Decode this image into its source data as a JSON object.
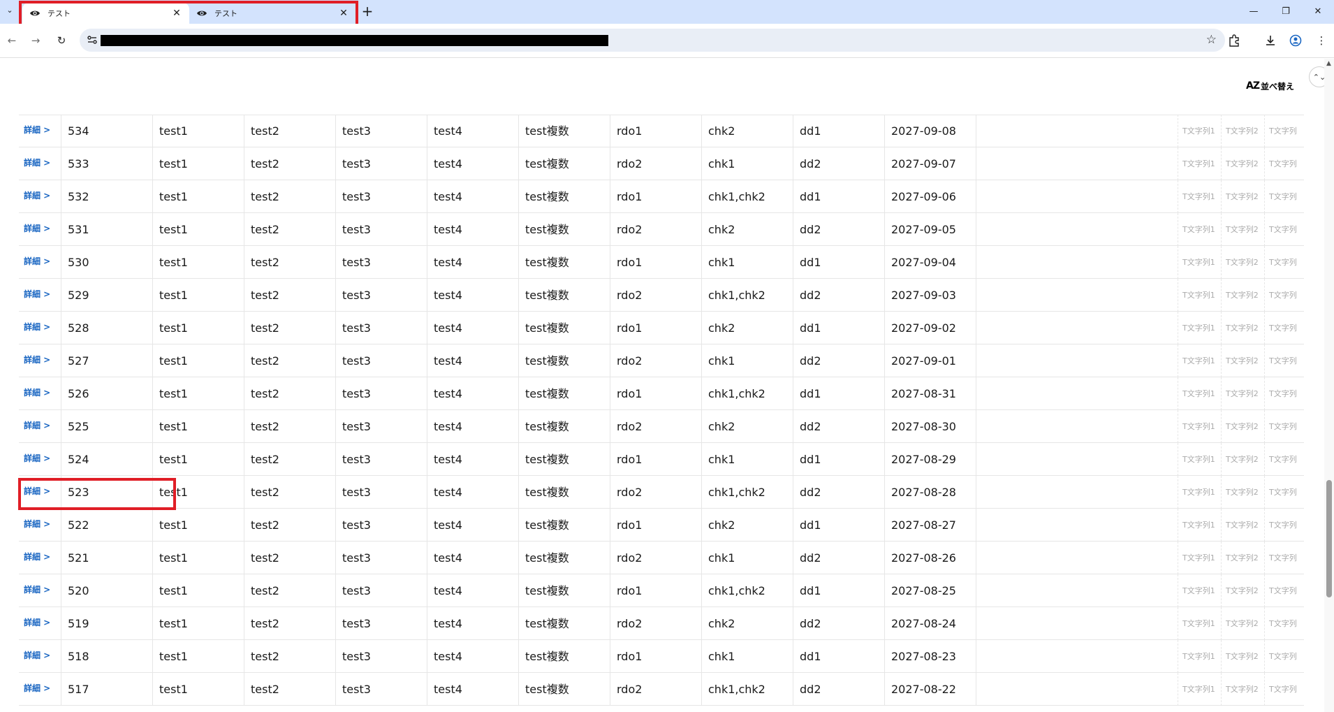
{
  "browser": {
    "tabs": [
      {
        "title": "テスト",
        "active": true
      },
      {
        "title": "テスト",
        "active": false
      }
    ],
    "tab_close": "✕",
    "new_tab": "+"
  },
  "page": {
    "sort_button": {
      "az": "AZ",
      "label": "並べ替え"
    },
    "detail_label": "詳細 >",
    "rows": [
      {
        "id": "534",
        "c1": "test1",
        "c2": "test2",
        "c3": "test3",
        "c4": "test4",
        "c5": "test複数",
        "rdo": "rdo1",
        "chk": "chk2",
        "dd": "dd1",
        "date": "2027-09-08"
      },
      {
        "id": "533",
        "c1": "test1",
        "c2": "test2",
        "c3": "test3",
        "c4": "test4",
        "c5": "test複数",
        "rdo": "rdo2",
        "chk": "chk1",
        "dd": "dd2",
        "date": "2027-09-07"
      },
      {
        "id": "532",
        "c1": "test1",
        "c2": "test2",
        "c3": "test3",
        "c4": "test4",
        "c5": "test複数",
        "rdo": "rdo1",
        "chk": "chk1,chk2",
        "dd": "dd1",
        "date": "2027-09-06"
      },
      {
        "id": "531",
        "c1": "test1",
        "c2": "test2",
        "c3": "test3",
        "c4": "test4",
        "c5": "test複数",
        "rdo": "rdo2",
        "chk": "chk2",
        "dd": "dd2",
        "date": "2027-09-05"
      },
      {
        "id": "530",
        "c1": "test1",
        "c2": "test2",
        "c3": "test3",
        "c4": "test4",
        "c5": "test複数",
        "rdo": "rdo1",
        "chk": "chk1",
        "dd": "dd1",
        "date": "2027-09-04"
      },
      {
        "id": "529",
        "c1": "test1",
        "c2": "test2",
        "c3": "test3",
        "c4": "test4",
        "c5": "test複数",
        "rdo": "rdo2",
        "chk": "chk1,chk2",
        "dd": "dd2",
        "date": "2027-09-03"
      },
      {
        "id": "528",
        "c1": "test1",
        "c2": "test2",
        "c3": "test3",
        "c4": "test4",
        "c5": "test複数",
        "rdo": "rdo1",
        "chk": "chk2",
        "dd": "dd1",
        "date": "2027-09-02"
      },
      {
        "id": "527",
        "c1": "test1",
        "c2": "test2",
        "c3": "test3",
        "c4": "test4",
        "c5": "test複数",
        "rdo": "rdo2",
        "chk": "chk1",
        "dd": "dd2",
        "date": "2027-09-01"
      },
      {
        "id": "526",
        "c1": "test1",
        "c2": "test2",
        "c3": "test3",
        "c4": "test4",
        "c5": "test複数",
        "rdo": "rdo1",
        "chk": "chk1,chk2",
        "dd": "dd1",
        "date": "2027-08-31"
      },
      {
        "id": "525",
        "c1": "test1",
        "c2": "test2",
        "c3": "test3",
        "c4": "test4",
        "c5": "test複数",
        "rdo": "rdo2",
        "chk": "chk2",
        "dd": "dd2",
        "date": "2027-08-30"
      },
      {
        "id": "524",
        "c1": "test1",
        "c2": "test2",
        "c3": "test3",
        "c4": "test4",
        "c5": "test複数",
        "rdo": "rdo1",
        "chk": "chk1",
        "dd": "dd1",
        "date": "2027-08-29"
      },
      {
        "id": "523",
        "c1": "test1",
        "c2": "test2",
        "c3": "test3",
        "c4": "test4",
        "c5": "test複数",
        "rdo": "rdo2",
        "chk": "chk1,chk2",
        "dd": "dd2",
        "date": "2027-08-28"
      },
      {
        "id": "522",
        "c1": "test1",
        "c2": "test2",
        "c3": "test3",
        "c4": "test4",
        "c5": "test複数",
        "rdo": "rdo1",
        "chk": "chk2",
        "dd": "dd1",
        "date": "2027-08-27"
      },
      {
        "id": "521",
        "c1": "test1",
        "c2": "test2",
        "c3": "test3",
        "c4": "test4",
        "c5": "test複数",
        "rdo": "rdo2",
        "chk": "chk1",
        "dd": "dd2",
        "date": "2027-08-26"
      },
      {
        "id": "520",
        "c1": "test1",
        "c2": "test2",
        "c3": "test3",
        "c4": "test4",
        "c5": "test複数",
        "rdo": "rdo1",
        "chk": "chk1,chk2",
        "dd": "dd1",
        "date": "2027-08-25"
      },
      {
        "id": "519",
        "c1": "test1",
        "c2": "test2",
        "c3": "test3",
        "c4": "test4",
        "c5": "test複数",
        "rdo": "rdo2",
        "chk": "chk2",
        "dd": "dd2",
        "date": "2027-08-24"
      },
      {
        "id": "518",
        "c1": "test1",
        "c2": "test2",
        "c3": "test3",
        "c4": "test4",
        "c5": "test複数",
        "rdo": "rdo1",
        "chk": "chk1",
        "dd": "dd1",
        "date": "2027-08-23"
      },
      {
        "id": "517",
        "c1": "test1",
        "c2": "test2",
        "c3": "test3",
        "c4": "test4",
        "c5": "test複数",
        "rdo": "rdo2",
        "chk": "chk1,chk2",
        "dd": "dd2",
        "date": "2027-08-22"
      }
    ],
    "trailing_cells": [
      "T文字列1",
      "T文字列2",
      "T文字列"
    ]
  },
  "colors": {
    "tabstrip_bg": "#d3e3fd",
    "highlight": "#e01e26",
    "link_blue": "#1a66c2"
  }
}
